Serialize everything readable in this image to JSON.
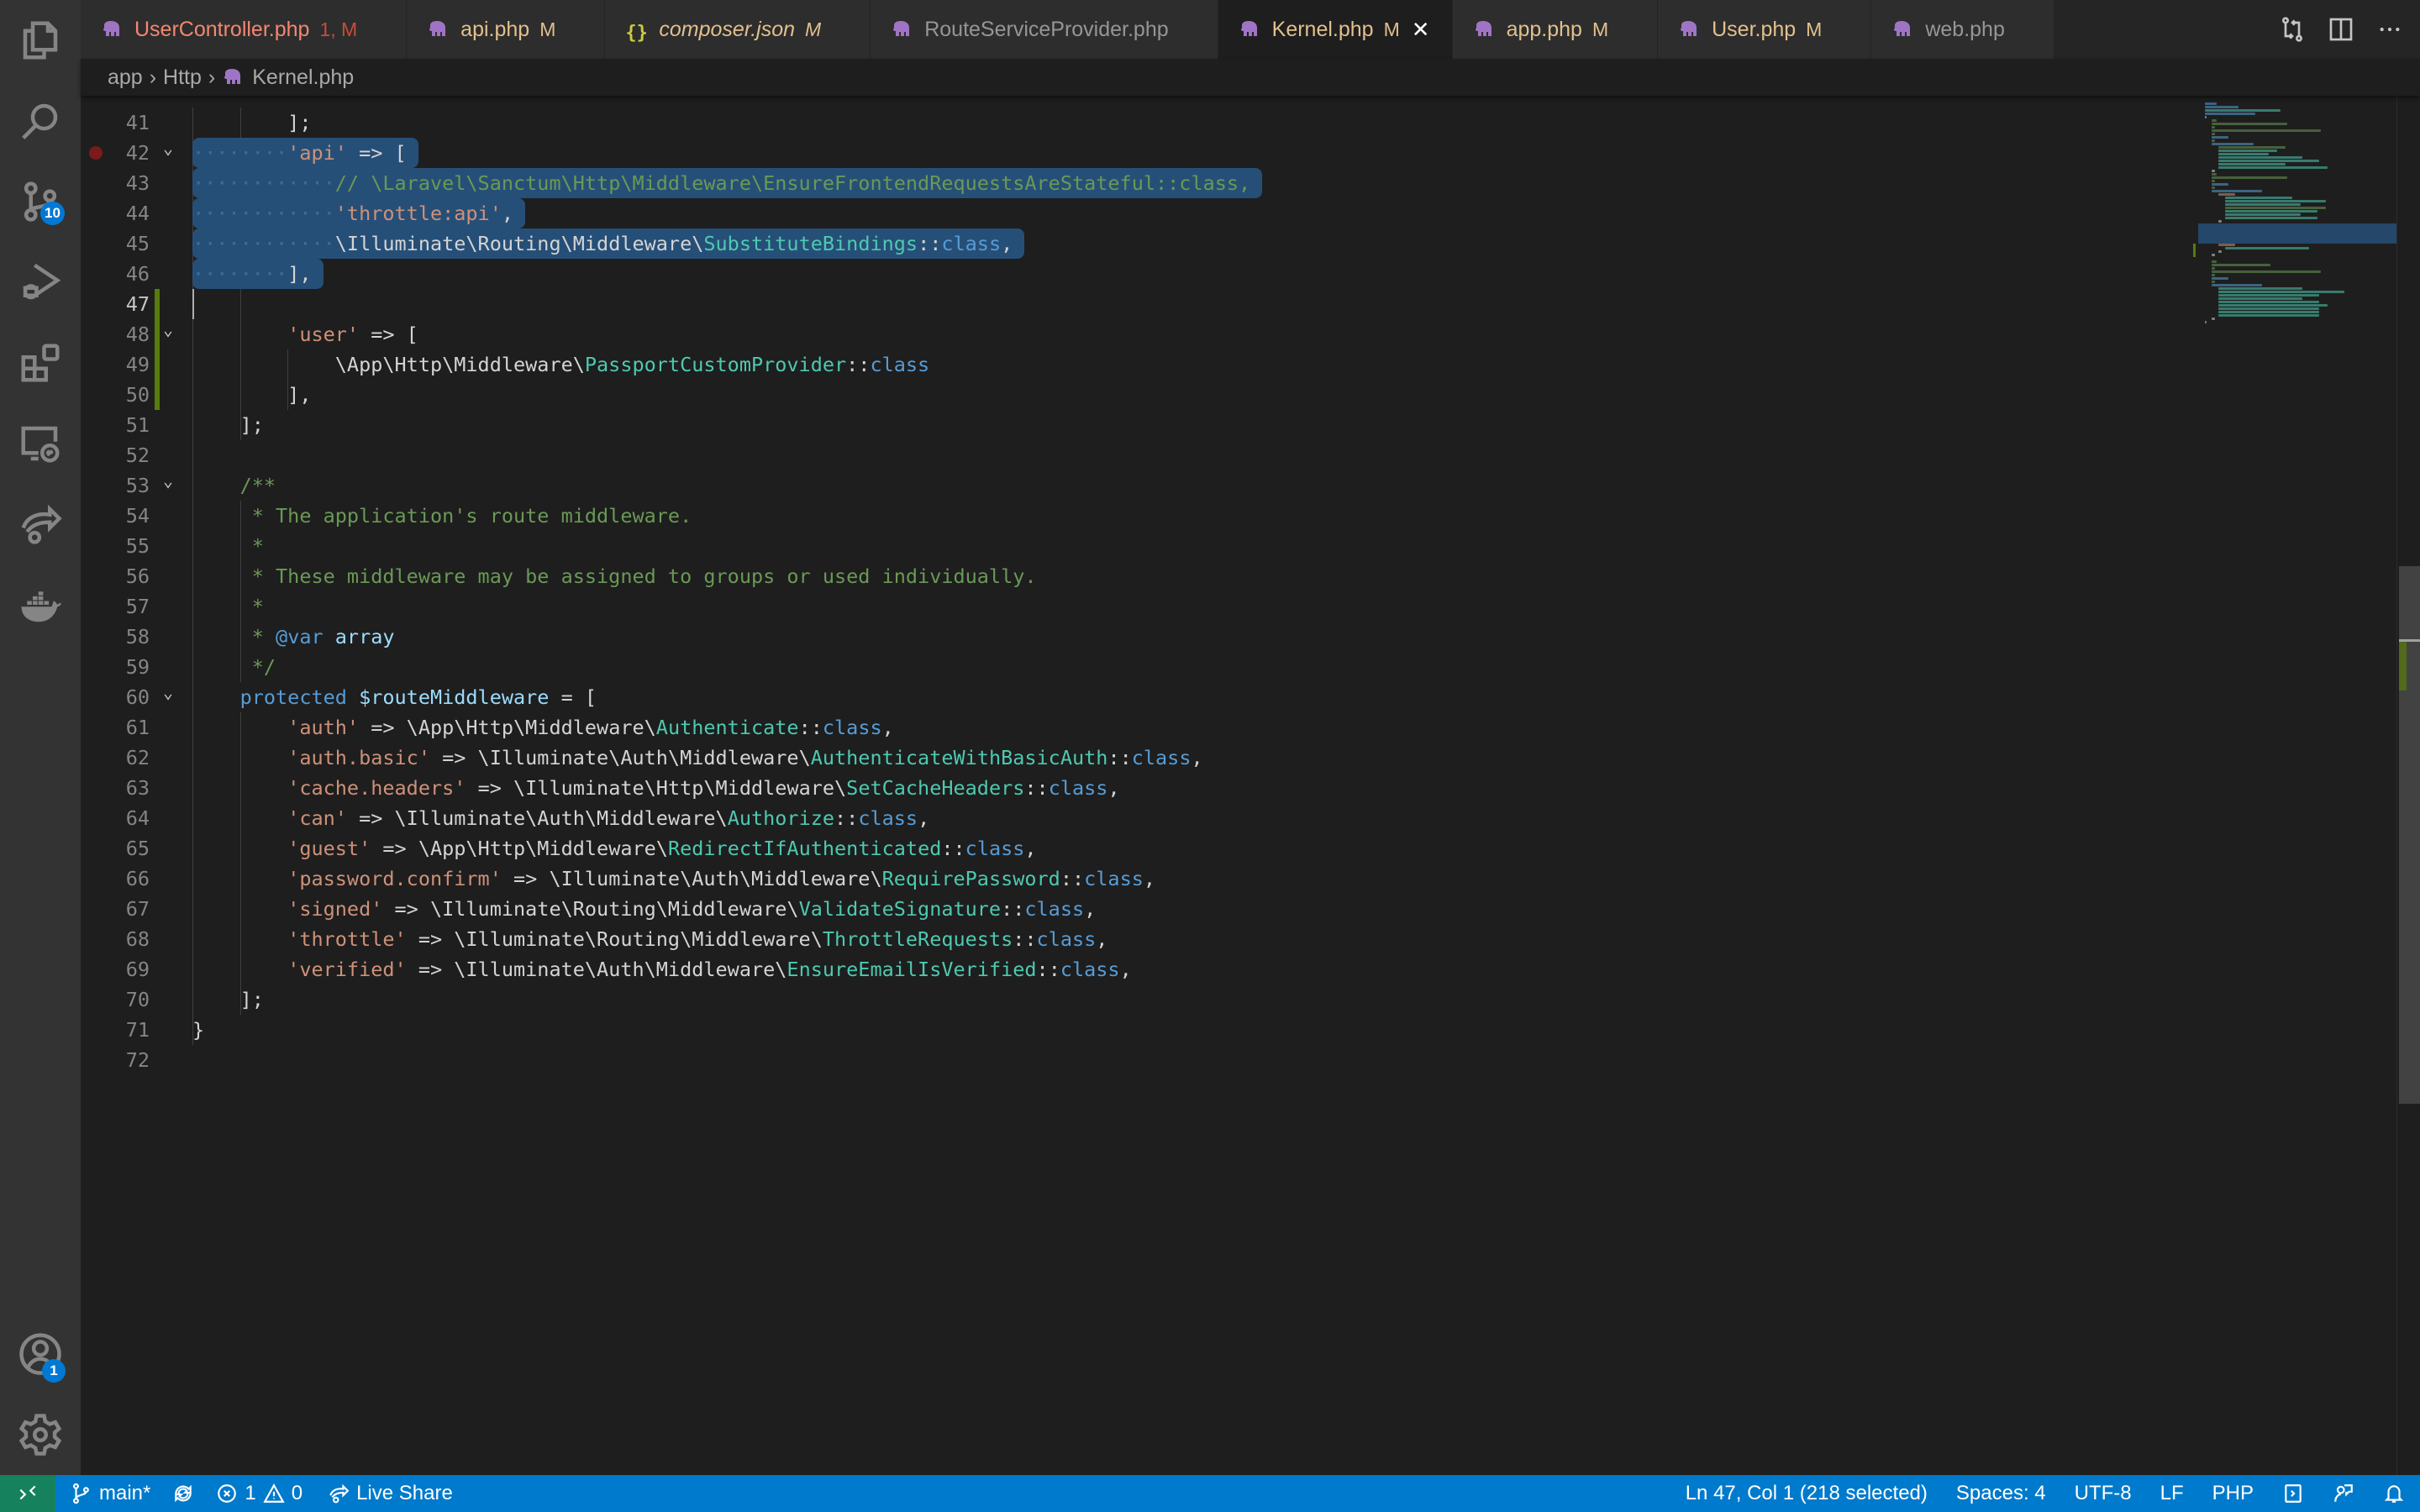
{
  "activity_bar": {
    "items": [
      {
        "name": "explorer"
      },
      {
        "name": "search"
      },
      {
        "name": "source-control",
        "badge": "10"
      },
      {
        "name": "run-and-debug"
      },
      {
        "name": "extensions"
      },
      {
        "name": "remote-explorer"
      },
      {
        "name": "live-share"
      },
      {
        "name": "docker"
      }
    ],
    "accounts_badge": "1"
  },
  "tabs": [
    {
      "label": "UserController.php",
      "status": "1, M",
      "icon": "php-elephant-icon",
      "color": "#f48771",
      "status_color": "#c74e39",
      "active": false,
      "italic": false
    },
    {
      "label": "api.php",
      "status": "M",
      "icon": "php-elephant-icon",
      "color": "#e2c08d",
      "status_color": "#e2c08d",
      "active": false,
      "italic": false
    },
    {
      "label": "composer.json",
      "status": "M",
      "icon": "json-braces-icon",
      "color": "#e2c08d",
      "status_color": "#e2c08d",
      "active": false,
      "italic": true
    },
    {
      "label": "RouteServiceProvider.php",
      "status": "",
      "icon": "php-elephant-icon",
      "color": "#969696",
      "status_color": "",
      "active": false,
      "italic": false
    },
    {
      "label": "Kernel.php",
      "status": "M",
      "icon": "php-elephant-icon",
      "color": "#e2c08d",
      "status_color": "#e2c08d",
      "active": true,
      "italic": false
    },
    {
      "label": "app.php",
      "status": "M",
      "icon": "php-elephant-icon",
      "color": "#e2c08d",
      "status_color": "#e2c08d",
      "active": false,
      "italic": false
    },
    {
      "label": "User.php",
      "status": "M",
      "icon": "php-elephant-icon",
      "color": "#e2c08d",
      "status_color": "#e2c08d",
      "active": false,
      "italic": false
    },
    {
      "label": "web.php",
      "status": "",
      "icon": "php-elephant-icon",
      "color": "#969696",
      "status_color": "",
      "active": false,
      "italic": false
    }
  ],
  "tab_close_glyph": "✕",
  "breadcrumb": [
    "app",
    "Http",
    "Kernel.php"
  ],
  "breadcrumb_sep": "›",
  "editor": {
    "first_line": 41,
    "current_line": 47,
    "lines": [
      {
        "n": 41,
        "tokens": []
      },
      {
        "n": 42,
        "fold": true,
        "breakpoint": true,
        "tokens": [
          [
            "ws",
            "········"
          ],
          [
            "str",
            "'api'"
          ],
          [
            "dim",
            " => ["
          ]
        ]
      },
      {
        "n": 43,
        "tokens": [
          [
            "ws",
            "············"
          ],
          [
            "cmt",
            "// \\Laravel\\Sanctum\\Http\\Middleware\\EnsureFrontendRequestsAreStateful::class,"
          ]
        ]
      },
      {
        "n": 44,
        "tokens": [
          [
            "ws",
            "············"
          ],
          [
            "str",
            "'throttle:api'"
          ],
          [
            "dim",
            ","
          ]
        ]
      },
      {
        "n": 45,
        "tokens": [
          [
            "ws",
            "············"
          ],
          [
            "dim",
            "\\Illuminate\\Routing\\Middleware\\"
          ],
          [
            "cls",
            "SubstituteBindings"
          ],
          [
            "dim",
            "::"
          ],
          [
            "kw",
            "class"
          ],
          [
            "dim",
            ","
          ]
        ]
      },
      {
        "n": 46,
        "tokens": [
          [
            "ws",
            "········"
          ],
          [
            "dim",
            "],"
          ]
        ]
      },
      {
        "n": 47,
        "tokens": []
      },
      {
        "n": 48,
        "fold": true,
        "tokens": [
          [
            "dim",
            "        "
          ],
          [
            "str",
            "'user'"
          ],
          [
            "dim",
            " => ["
          ]
        ]
      },
      {
        "n": 49,
        "tokens": [
          [
            "dim",
            "            \\App\\Http\\Middleware\\"
          ],
          [
            "cls",
            "PassportCustomProvider"
          ],
          [
            "dim",
            "::"
          ],
          [
            "kw",
            "class"
          ]
        ]
      },
      {
        "n": 50,
        "tokens": [
          [
            "dim",
            "        ],"
          ]
        ]
      },
      {
        "n": 51,
        "tokens": [
          [
            "dim",
            "    ];"
          ]
        ]
      },
      {
        "n": 52,
        "tokens": []
      },
      {
        "n": 53,
        "fold": true,
        "tokens": [
          [
            "cmt",
            "    /**"
          ]
        ]
      },
      {
        "n": 54,
        "tokens": [
          [
            "cmt",
            "     * The application's route middleware."
          ]
        ]
      },
      {
        "n": 55,
        "tokens": [
          [
            "cmt",
            "     *"
          ]
        ]
      },
      {
        "n": 56,
        "tokens": [
          [
            "cmt",
            "     * These middleware may be assigned to groups or used individually."
          ]
        ]
      },
      {
        "n": 57,
        "tokens": [
          [
            "cmt",
            "     *"
          ]
        ]
      },
      {
        "n": 58,
        "tokens": [
          [
            "cmt",
            "     * "
          ],
          [
            "kw",
            "@var"
          ],
          [
            "var",
            " array"
          ]
        ]
      },
      {
        "n": 59,
        "tokens": [
          [
            "cmt",
            "     */"
          ]
        ]
      },
      {
        "n": 60,
        "fold": true,
        "tokens": [
          [
            "kw",
            "    protected "
          ],
          [
            "var",
            "$routeMiddleware"
          ],
          [
            "dim",
            " = ["
          ]
        ]
      },
      {
        "n": 61,
        "tokens": [
          [
            "dim",
            "        "
          ],
          [
            "str",
            "'auth'"
          ],
          [
            "dim",
            " => \\App\\Http\\Middleware\\"
          ],
          [
            "cls",
            "Authenticate"
          ],
          [
            "dim",
            "::"
          ],
          [
            "kw",
            "class"
          ],
          [
            "dim",
            ","
          ]
        ]
      },
      {
        "n": 62,
        "tokens": [
          [
            "dim",
            "        "
          ],
          [
            "str",
            "'auth.basic'"
          ],
          [
            "dim",
            " => \\Illuminate\\Auth\\Middleware\\"
          ],
          [
            "cls",
            "AuthenticateWithBasicAuth"
          ],
          [
            "dim",
            "::"
          ],
          [
            "kw",
            "class"
          ],
          [
            "dim",
            ","
          ]
        ]
      },
      {
        "n": 63,
        "tokens": [
          [
            "dim",
            "        "
          ],
          [
            "str",
            "'cache.headers'"
          ],
          [
            "dim",
            " => \\Illuminate\\Http\\Middleware\\"
          ],
          [
            "cls",
            "SetCacheHeaders"
          ],
          [
            "dim",
            "::"
          ],
          [
            "kw",
            "class"
          ],
          [
            "dim",
            ","
          ]
        ]
      },
      {
        "n": 64,
        "tokens": [
          [
            "dim",
            "        "
          ],
          [
            "str",
            "'can'"
          ],
          [
            "dim",
            " => \\Illuminate\\Auth\\Middleware\\"
          ],
          [
            "cls",
            "Authorize"
          ],
          [
            "dim",
            "::"
          ],
          [
            "kw",
            "class"
          ],
          [
            "dim",
            ","
          ]
        ]
      },
      {
        "n": 65,
        "tokens": [
          [
            "dim",
            "        "
          ],
          [
            "str",
            "'guest'"
          ],
          [
            "dim",
            " => \\App\\Http\\Middleware\\"
          ],
          [
            "cls",
            "RedirectIfAuthenticated"
          ],
          [
            "dim",
            "::"
          ],
          [
            "kw",
            "class"
          ],
          [
            "dim",
            ","
          ]
        ]
      },
      {
        "n": 66,
        "tokens": [
          [
            "dim",
            "        "
          ],
          [
            "str",
            "'password.confirm'"
          ],
          [
            "dim",
            " => \\Illuminate\\Auth\\Middleware\\"
          ],
          [
            "cls",
            "RequirePassword"
          ],
          [
            "dim",
            "::"
          ],
          [
            "kw",
            "class"
          ],
          [
            "dim",
            ","
          ]
        ]
      },
      {
        "n": 67,
        "tokens": [
          [
            "dim",
            "        "
          ],
          [
            "str",
            "'signed'"
          ],
          [
            "dim",
            " => \\Illuminate\\Routing\\Middleware\\"
          ],
          [
            "cls",
            "ValidateSignature"
          ],
          [
            "dim",
            "::"
          ],
          [
            "kw",
            "class"
          ],
          [
            "dim",
            ","
          ]
        ]
      },
      {
        "n": 68,
        "tokens": [
          [
            "dim",
            "        "
          ],
          [
            "str",
            "'throttle'"
          ],
          [
            "dim",
            " => \\Illuminate\\Routing\\Middleware\\"
          ],
          [
            "cls",
            "ThrottleRequests"
          ],
          [
            "dim",
            "::"
          ],
          [
            "kw",
            "class"
          ],
          [
            "dim",
            ","
          ]
        ]
      },
      {
        "n": 69,
        "tokens": [
          [
            "dim",
            "        "
          ],
          [
            "str",
            "'verified'"
          ],
          [
            "dim",
            " => \\Illuminate\\Auth\\Middleware\\"
          ],
          [
            "cls",
            "EnsureEmailIsVerified"
          ],
          [
            "dim",
            "::"
          ],
          [
            "kw",
            "class"
          ],
          [
            "dim",
            ","
          ]
        ]
      },
      {
        "n": 70,
        "tokens": [
          [
            "dim",
            "    ];"
          ]
        ]
      },
      {
        "n": 71,
        "tokens": [
          [
            "dim",
            "}"
          ]
        ]
      },
      {
        "n": 72,
        "tokens": []
      }
    ],
    "selection_lines": [
      42,
      43,
      44,
      45,
      46
    ],
    "modified_lines": [
      47,
      48,
      49,
      50
    ]
  },
  "statusbar": {
    "branch": "main*",
    "errors": "1",
    "warnings": "0",
    "live_share": "Live Share",
    "cursor_position": "Ln 47, Col 1 (218 selected)",
    "indentation": "Spaces: 4",
    "encoding": "UTF-8",
    "eol": "LF",
    "language": "PHP"
  },
  "colors": {
    "accent": "#007acc",
    "remote": "#16825d",
    "selection": "#264f78",
    "modified_gutter": "#587c0c",
    "php_icon": "#a074c4"
  }
}
